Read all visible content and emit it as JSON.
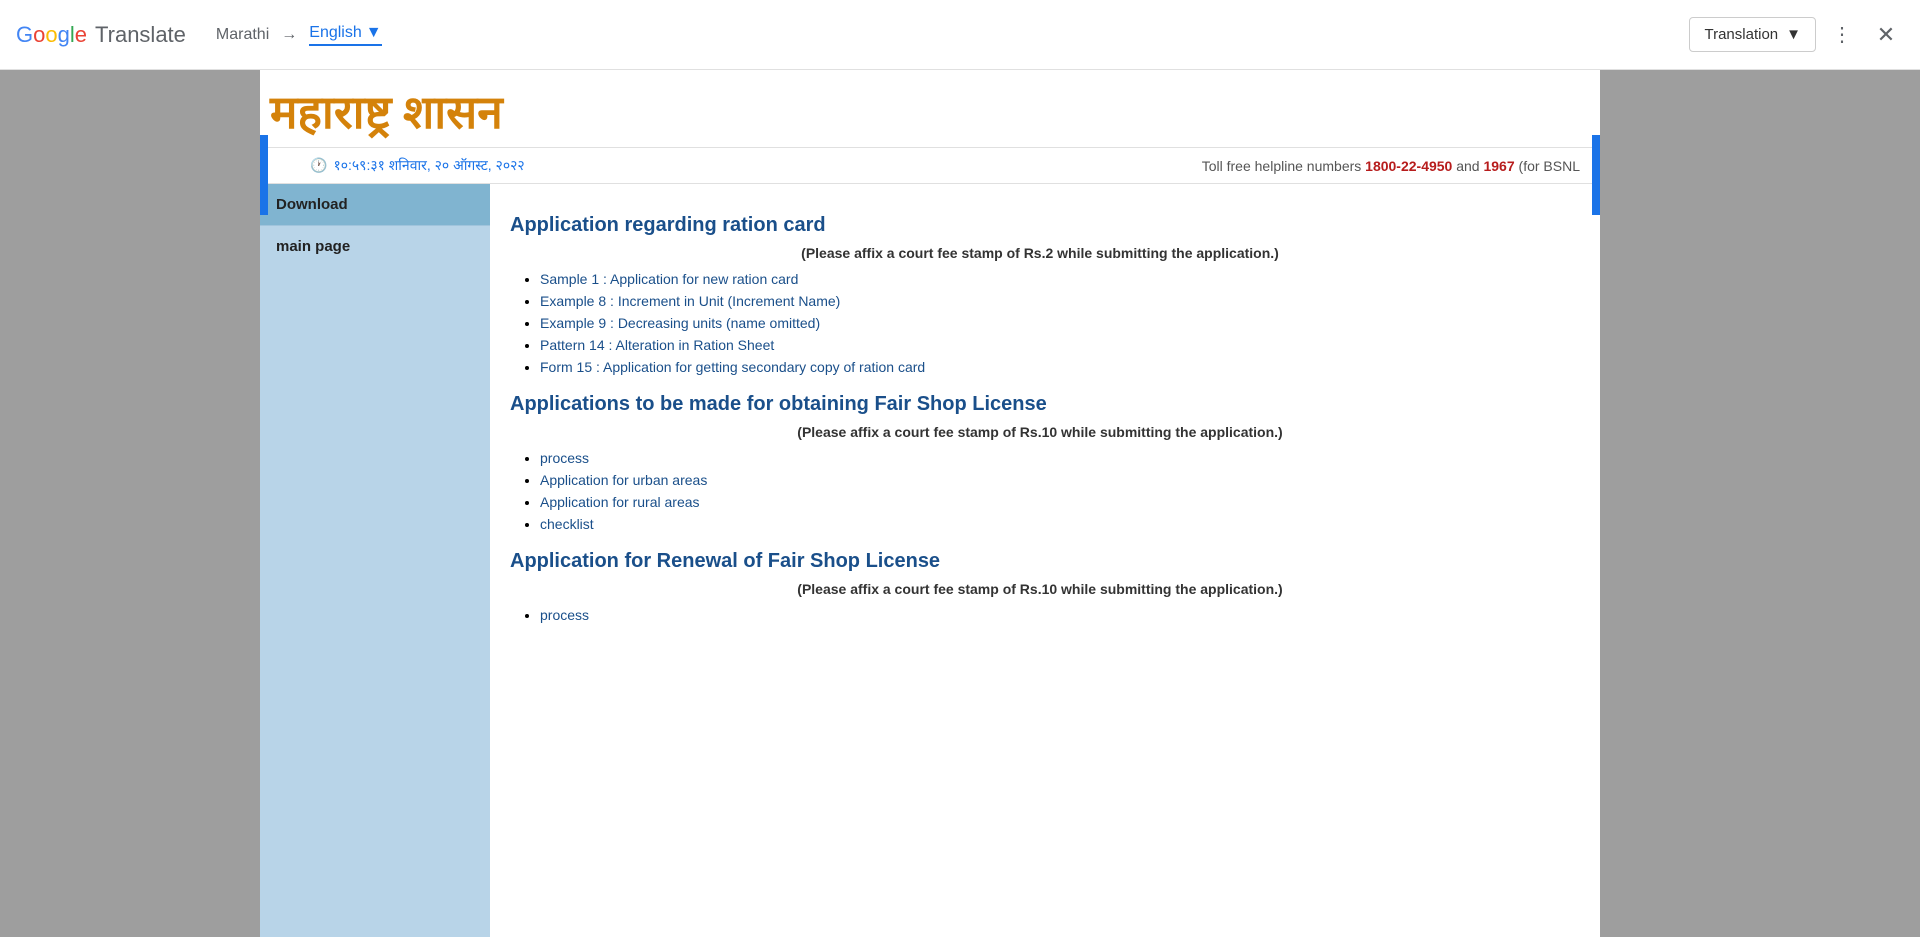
{
  "topbar": {
    "google_text": "Google",
    "translate_text": "Translate",
    "source_lang": "Marathi",
    "arrow": "→",
    "target_lang": "English",
    "dropdown_chevron": "▼",
    "translation_label": "Translation",
    "more_options_icon": "⋮",
    "close_icon": "✕"
  },
  "header": {
    "marathi_heading": "महाराष्ट्र शासन"
  },
  "infobar": {
    "clock_icon": "🕐",
    "datetime": "१०:५९:३१ शनिवार, २० ऑगस्ट, २०२२",
    "helpline_text": "Toll free helpline numbers",
    "number1": "1800-22-4950",
    "and_text": "and",
    "number2": "1967",
    "bsnl_text": "(for BSNL"
  },
  "sidebar": {
    "download_label": "Download",
    "mainpage_label": "main page"
  },
  "content": {
    "section1_title": "Application regarding ration card",
    "section1_note": "(Please affix a court fee stamp of Rs.2 while submitting the application.)",
    "section1_links": [
      "Sample 1 : Application for new ration card",
      "Example 8 : Increment in Unit (Increment Name)",
      "Example 9 : Decreasing units (name omitted)",
      "Pattern 14 : Alteration in Ration Sheet",
      "Form 15 : Application for getting secondary copy of ration card"
    ],
    "section2_title": "Applications to be made for obtaining Fair Shop License",
    "section2_note": "(Please affix a court fee stamp of Rs.10 while submitting the application.)",
    "section2_links": [
      "process",
      "Application for urban areas",
      "Application for rural areas",
      "checklist"
    ],
    "section3_title": "Application for Renewal of Fair Shop License",
    "section3_note": "(Please affix a court fee stamp of Rs.10 while submitting the application.)",
    "section3_links": [
      "process"
    ]
  }
}
